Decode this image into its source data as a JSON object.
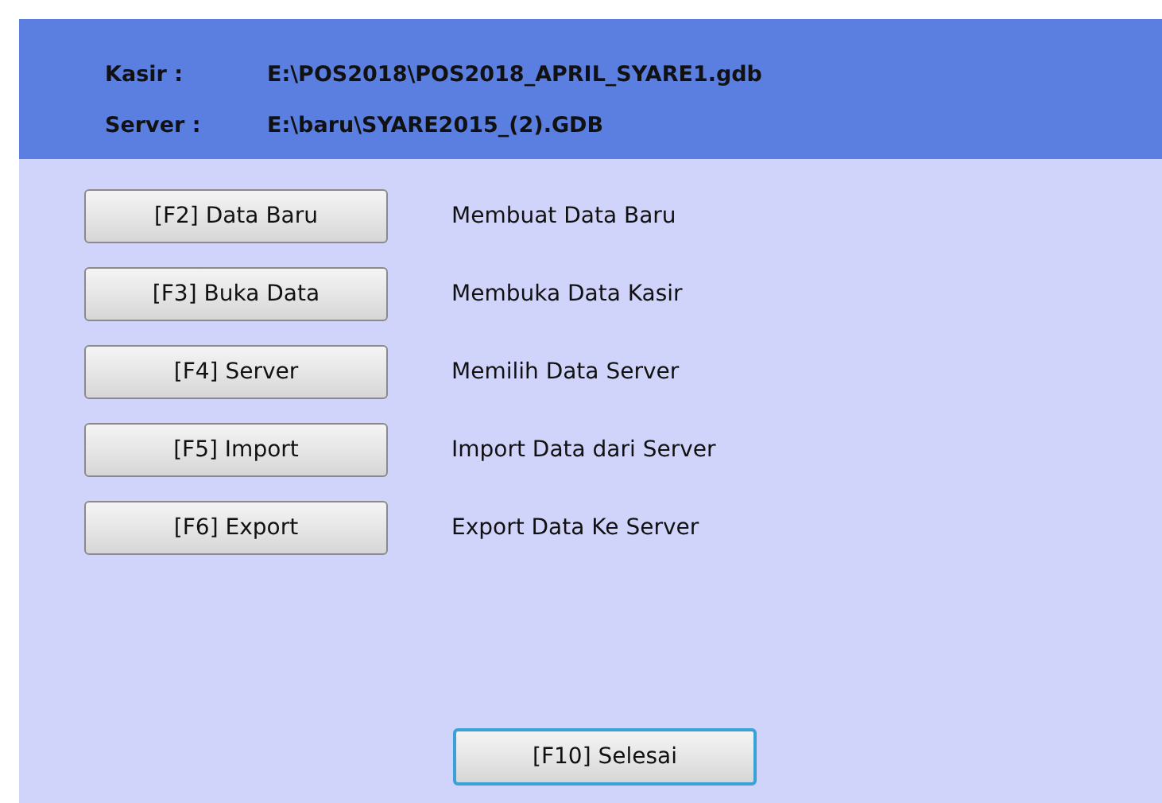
{
  "header": {
    "rows": [
      {
        "label": "Kasir :",
        "value": "E:\\POS2018\\POS2018_APRIL_SYARE1.gdb"
      },
      {
        "label": "Server :",
        "value": "E:\\baru\\SYARE2015_(2).GDB"
      }
    ]
  },
  "actions": [
    {
      "button": "[F2] Data Baru",
      "description": "Membuat Data Baru",
      "focused": false
    },
    {
      "button": "[F3] Buka Data",
      "description": "Membuka Data Kasir",
      "focused": false
    },
    {
      "button": "[F4] Server",
      "description": "Memilih Data Server",
      "focused": false
    },
    {
      "button": "[F5] Import",
      "description": "Import Data dari Server",
      "focused": false
    },
    {
      "button": "[F6] Export",
      "description": "Export Data Ke Server",
      "focused": false
    }
  ],
  "finish_button": {
    "label": "[F10] Selesai",
    "focused": true
  }
}
